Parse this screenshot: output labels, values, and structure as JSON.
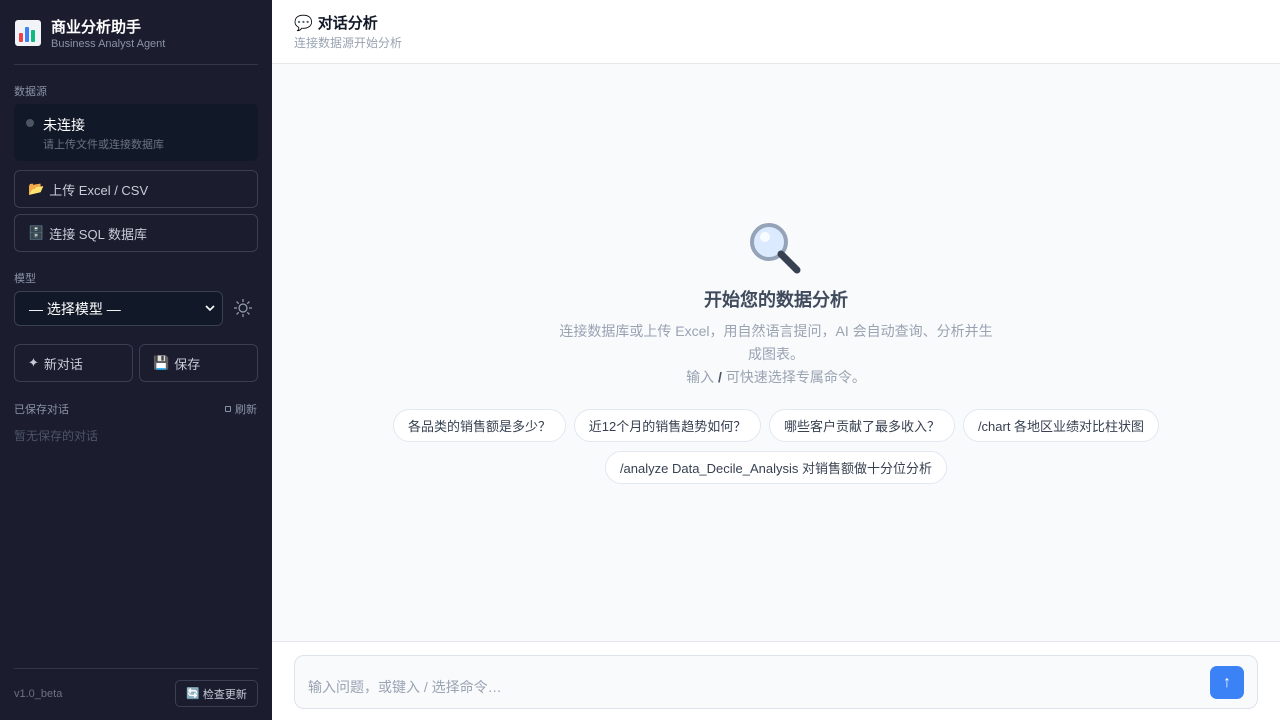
{
  "sidebar": {
    "brand": {
      "title": "商业分析助手",
      "subtitle": "Business Analyst Agent",
      "icon": "bar-chart-icon"
    },
    "datasource": {
      "label": "数据源",
      "status_title": "未连接",
      "status_sub": "请上传文件或连接数据库",
      "upload_label": "上传 Excel / CSV",
      "upload_icon": "folder-icon",
      "sql_label": "连接 SQL 数据库",
      "sql_icon": "database-icon"
    },
    "model": {
      "label": "模型",
      "selected": "— 选择模型 —",
      "theme_icon": "sun-icon"
    },
    "new_chat_label": "新对话",
    "save_label": "保存",
    "saved": {
      "label": "已保存对话",
      "refresh_label": "刷新",
      "empty_text": "暂无保存的对话"
    },
    "footer": {
      "version": "v1.0_beta",
      "update_label": "检查更新"
    }
  },
  "header": {
    "title": "对话分析",
    "subtitle": "连接数据源开始分析",
    "icon": "speech-bubble-icon"
  },
  "welcome": {
    "icon": "magnifier-icon",
    "title": "开始您的数据分析",
    "desc": "连接数据库或上传 Excel，用自然语言提问，AI 会自动查询、分析并生成图表。",
    "hint_prefix": "输入",
    "hint_key": "/",
    "hint_suffix": "可快速选择专属命令。"
  },
  "suggestions": [
    "各品类的销售额是多少？",
    "近12个月的销售趋势如何？",
    "哪些客户贡献了最多收入？",
    "/chart 各地区业绩对比柱状图",
    "/analyze Data_Decile_Analysis 对销售额做十分位分析"
  ],
  "input": {
    "placeholder": "输入问题，或键入 / 选择命令…",
    "send_symbol": "↑"
  },
  "colors": {
    "sidebar_bg": "#1b1c2e",
    "accent": "#3b82f6"
  }
}
